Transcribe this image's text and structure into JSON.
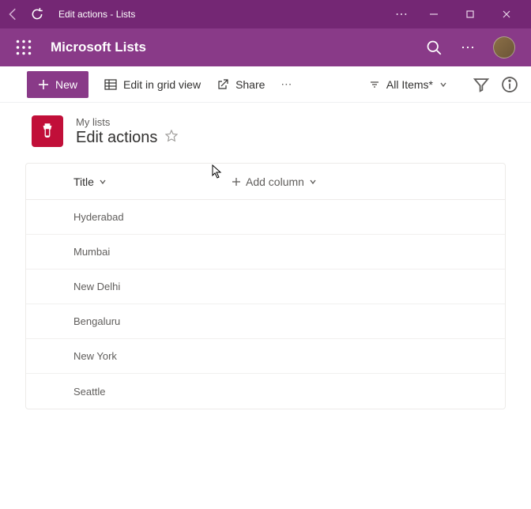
{
  "titlebar": {
    "title": "Edit actions - Lists"
  },
  "appbar": {
    "title": "Microsoft Lists"
  },
  "commands": {
    "new": "New",
    "edit_grid": "Edit in grid view",
    "share": "Share",
    "view_label": "All Items*"
  },
  "header": {
    "breadcrumb": "My lists",
    "list_name": "Edit actions"
  },
  "columns": {
    "title": "Title",
    "add": "Add column"
  },
  "rows": [
    {
      "title": "Hyderabad"
    },
    {
      "title": "Mumbai"
    },
    {
      "title": "New Delhi"
    },
    {
      "title": "Bengaluru"
    },
    {
      "title": "New York"
    },
    {
      "title": "Seattle"
    }
  ]
}
